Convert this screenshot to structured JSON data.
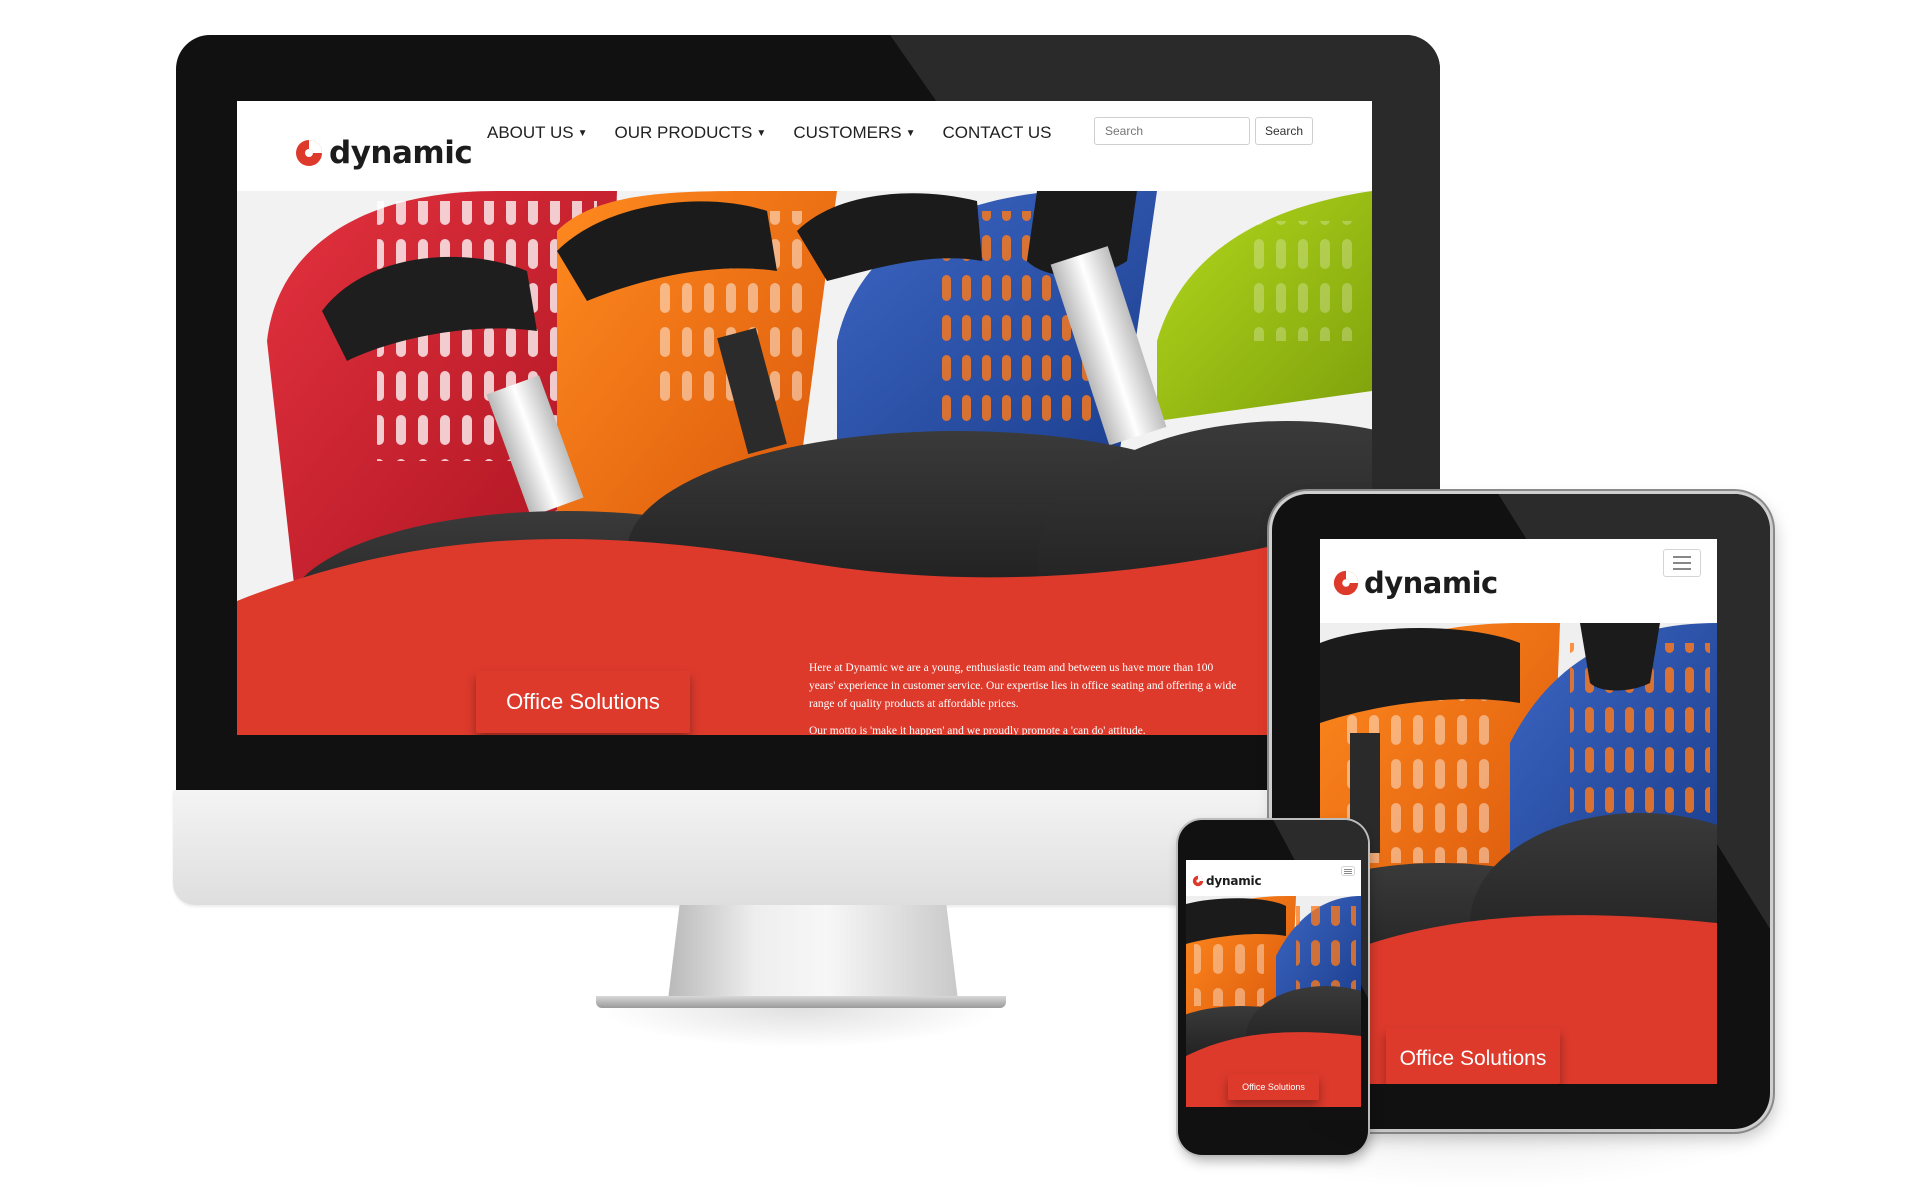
{
  "brand": {
    "name": "dynamic",
    "red": "#dd3a2c",
    "dark_red": "#b12c22",
    "logo_icon": "swirl-logo-icon"
  },
  "desktop": {
    "nav": {
      "items": [
        {
          "label": "ABOUT US",
          "has_dropdown": true
        },
        {
          "label": "OUR PRODUCTS",
          "has_dropdown": true
        },
        {
          "label": "CUSTOMERS",
          "has_dropdown": true
        },
        {
          "label": "CONTACT US",
          "has_dropdown": false
        }
      ],
      "caret_icon": "caret-down-icon"
    },
    "search": {
      "placeholder": "Search",
      "button_label": "Search"
    },
    "hero": {
      "cta_label": "Office Solutions",
      "intro_paragraphs": [
        "Here at Dynamic we are a young, enthusiastic team and between us have more than 100 years' experience in customer service. Our expertise lies in office seating and offering a wide range of quality products at affordable prices.",
        "Our motto is 'make it happen' and we proudly promote a 'can do' attitude."
      ]
    }
  },
  "tablet": {
    "menu_icon": "hamburger-menu-icon",
    "cta_label": "Office Solutions"
  },
  "phone": {
    "menu_icon": "hamburger-menu-icon",
    "cta_label": "Office Solutions"
  }
}
